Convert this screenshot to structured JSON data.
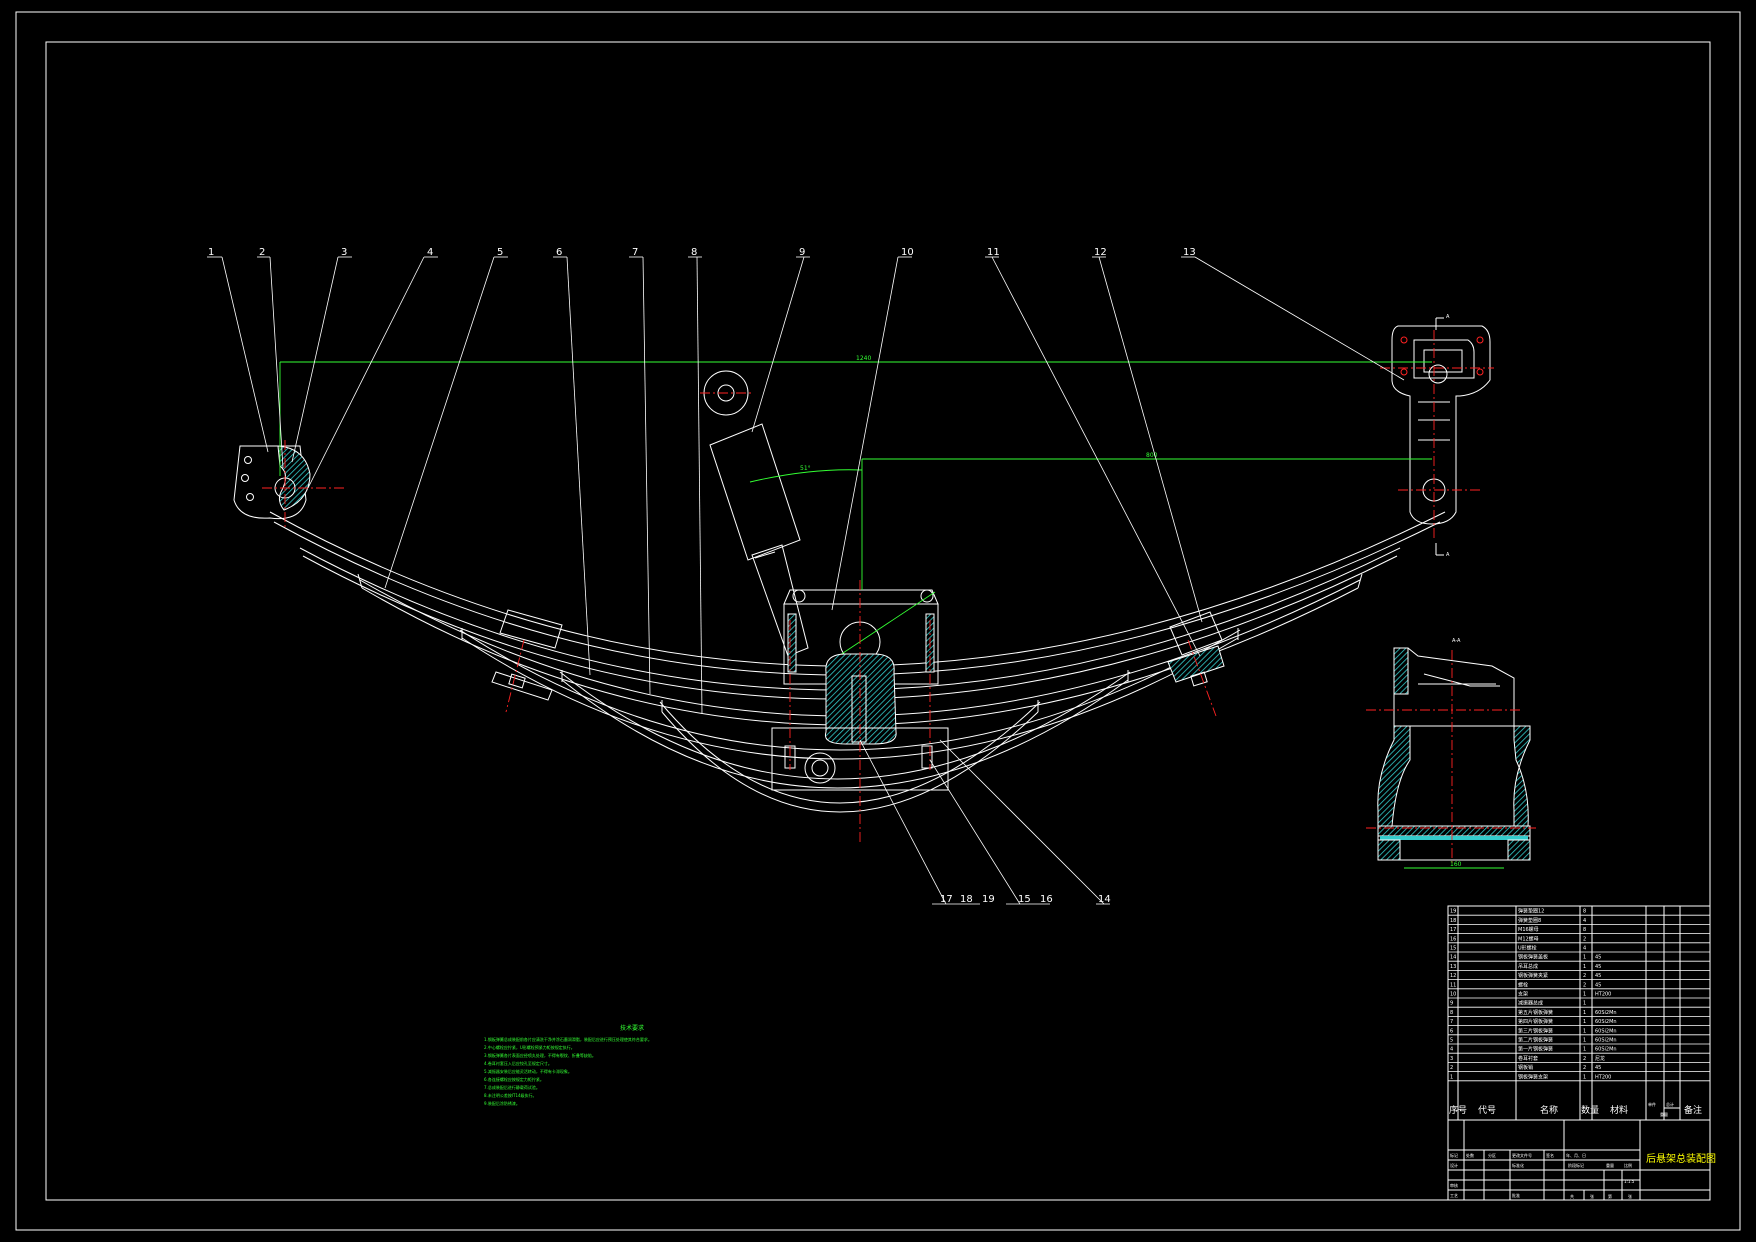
{
  "drawing": {
    "callouts_top": [
      "1",
      "2",
      "3",
      "4",
      "5",
      "6",
      "7",
      "8",
      "9",
      "10",
      "11",
      "12",
      "13"
    ],
    "callouts_bottom": [
      "17",
      "18",
      "19",
      "15",
      "16",
      "14"
    ],
    "dimensions": {
      "span": "1240",
      "lower": "800",
      "angle": "51°",
      "section_width": "160"
    },
    "section_label_top": "A",
    "section_label_bottom": "A",
    "section_view_title": "A-A"
  },
  "notes": {
    "heading": "技术要求",
    "lines": [
      "1.钢板弹簧总成装配前各片应清洗干净并涂石墨润滑脂，装配后应进行预压处理使其符合要求。",
      "2.中心螺栓应拧紧，U形螺栓预紧力矩按规定执行。",
      "3.钢板弹簧各片表面应经喷丸处理，不得有裂纹、折叠等缺陷。",
      "4.卷耳衬套压入后应铰孔至规定尺寸。",
      "5.减振器安装后应能灵活转动，不得有卡滞现象。",
      "6.各连接螺栓应按规定力矩拧紧。",
      "7.总成装配后进行静载荷试验。",
      "8.未注明公差按IT14级执行。",
      "9.装配后涂防锈漆。"
    ]
  },
  "bom": {
    "rows": [
      {
        "no": "19",
        "name": "弹簧垫圈12",
        "qty": "8",
        "mat": ""
      },
      {
        "no": "18",
        "name": "弹簧垫圈8",
        "qty": "4",
        "mat": ""
      },
      {
        "no": "17",
        "name": "M16螺母",
        "qty": "8",
        "mat": ""
      },
      {
        "no": "16",
        "name": "M12螺母",
        "qty": "2",
        "mat": ""
      },
      {
        "no": "15",
        "name": "U形螺栓",
        "qty": "4",
        "mat": ""
      },
      {
        "no": "14",
        "name": "钢板弹簧盖板",
        "qty": "1",
        "mat": "45"
      },
      {
        "no": "13",
        "name": "吊耳总成",
        "qty": "1",
        "mat": "45"
      },
      {
        "no": "12",
        "name": "钢板弹簧夹紧",
        "qty": "2",
        "mat": "45"
      },
      {
        "no": "11",
        "name": "螺栓",
        "qty": "2",
        "mat": "45"
      },
      {
        "no": "10",
        "name": "支架",
        "qty": "1",
        "mat": "HT200"
      },
      {
        "no": "9",
        "name": "减振器总成",
        "qty": "1",
        "mat": ""
      },
      {
        "no": "8",
        "name": "第五片钢板弹簧",
        "qty": "1",
        "mat": "60Si2Mn"
      },
      {
        "no": "7",
        "name": "第四片钢板弹簧",
        "qty": "1",
        "mat": "60Si2Mn"
      },
      {
        "no": "6",
        "name": "第三片钢板弹簧",
        "qty": "1",
        "mat": "60Si2Mn"
      },
      {
        "no": "5",
        "name": "第二片钢板弹簧",
        "qty": "1",
        "mat": "60Si2Mn"
      },
      {
        "no": "4",
        "name": "第一片钢板弹簧",
        "qty": "1",
        "mat": "60Si2Mn"
      },
      {
        "no": "3",
        "name": "卷耳衬套",
        "qty": "2",
        "mat": "尼龙"
      },
      {
        "no": "2",
        "name": "钢板销",
        "qty": "2",
        "mat": "45"
      },
      {
        "no": "1",
        "name": "钢板弹簧支架",
        "qty": "1",
        "mat": "HT200"
      }
    ],
    "header": {
      "no": "序号",
      "code": "代号",
      "name": "名称",
      "qty": "数量",
      "mat": "材料",
      "unit": "单件",
      "total": "总计",
      "weight": "重量",
      "remark": "备注"
    }
  },
  "title_block": {
    "drawing_title": "后悬架总装配图",
    "scale": "1:1.5",
    "rows_left": [
      "标记",
      "处数",
      "分区",
      "更改文件号",
      "签名",
      "年、月、日"
    ],
    "designer": "设计",
    "standard": "标准化",
    "check": "审核",
    "process": "工艺",
    "approve": "批准",
    "stage": "阶段标记",
    "weight": "重量",
    "ratio": "比例",
    "sheets": [
      "共",
      "张",
      "第",
      "张"
    ]
  },
  "colors": {
    "line": "#ffffff",
    "dim": "#33ff33",
    "center": "#ff2222",
    "title": "#ffff00",
    "hatch": "#33cccc"
  }
}
